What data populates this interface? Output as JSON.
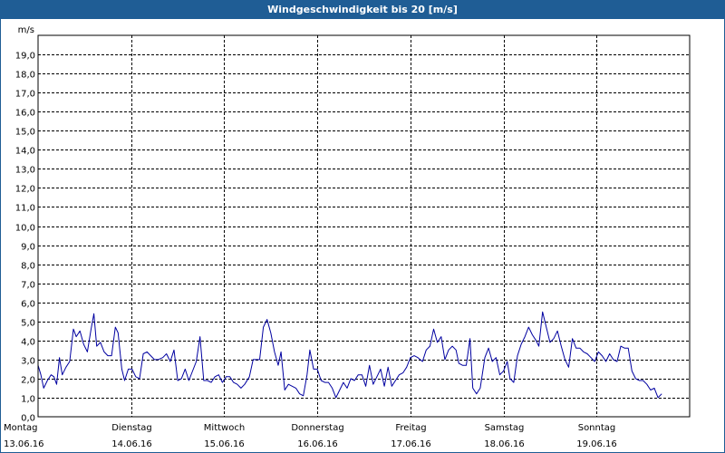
{
  "window": {
    "title": "Windgeschwindigkeit bis 20 [m/s]"
  },
  "colors": {
    "titlebar": "#1f5d95",
    "series": "#0000a0",
    "grid": "#000000"
  },
  "chart_data": {
    "type": "line",
    "title": "Windgeschwindigkeit bis 20 [m/s]",
    "ylabel": "m/s",
    "ylim": [
      0,
      20
    ],
    "y_ticks": [
      "0,0",
      "1,0",
      "2,0",
      "3,0",
      "4,0",
      "5,0",
      "6,0",
      "7,0",
      "8,0",
      "9,0",
      "10,0",
      "11,0",
      "12,0",
      "13,0",
      "14,0",
      "15,0",
      "16,0",
      "17,0",
      "18,0",
      "19,0"
    ],
    "x_unit": "days since 13.06.16 00:00",
    "xlim": [
      0,
      7
    ],
    "x_labels": [
      {
        "day": "Montag",
        "date": "13.06.16"
      },
      {
        "day": "Dienstag",
        "date": "14.06.16"
      },
      {
        "day": "Mittwoch",
        "date": "15.06.16"
      },
      {
        "day": "Donnerstag",
        "date": "16.06.16"
      },
      {
        "day": "Freitag",
        "date": "17.06.16"
      },
      {
        "day": "Samstag",
        "date": "18.06.16"
      },
      {
        "day": "Sonntag",
        "date": "19.06.16"
      }
    ],
    "grid": true,
    "series": [
      {
        "name": "",
        "color": "#0000a0",
        "points": [
          [
            0.0,
            2.7
          ],
          [
            0.03,
            2.2
          ],
          [
            0.06,
            1.5
          ],
          [
            0.1,
            1.9
          ],
          [
            0.14,
            2.2
          ],
          [
            0.17,
            2.1
          ],
          [
            0.2,
            1.7
          ],
          [
            0.23,
            3.1
          ],
          [
            0.26,
            2.2
          ],
          [
            0.3,
            2.6
          ],
          [
            0.34,
            2.9
          ],
          [
            0.38,
            4.6
          ],
          [
            0.41,
            4.2
          ],
          [
            0.45,
            4.5
          ],
          [
            0.49,
            3.8
          ],
          [
            0.53,
            3.4
          ],
          [
            0.57,
            4.6
          ],
          [
            0.6,
            5.4
          ],
          [
            0.63,
            3.7
          ],
          [
            0.67,
            3.9
          ],
          [
            0.71,
            3.4
          ],
          [
            0.75,
            3.2
          ],
          [
            0.79,
            3.2
          ],
          [
            0.83,
            4.7
          ],
          [
            0.86,
            4.4
          ],
          [
            0.9,
            2.5
          ],
          [
            0.93,
            1.9
          ],
          [
            0.97,
            2.5
          ],
          [
            1.01,
            2.5
          ],
          [
            1.05,
            2.1
          ],
          [
            1.09,
            2.0
          ],
          [
            1.13,
            3.3
          ],
          [
            1.17,
            3.4
          ],
          [
            1.21,
            3.2
          ],
          [
            1.25,
            3.0
          ],
          [
            1.29,
            3.0
          ],
          [
            1.34,
            3.1
          ],
          [
            1.38,
            3.3
          ],
          [
            1.42,
            2.9
          ],
          [
            1.46,
            3.5
          ],
          [
            1.5,
            1.9
          ],
          [
            1.54,
            2.0
          ],
          [
            1.58,
            2.5
          ],
          [
            1.62,
            1.9
          ],
          [
            1.66,
            2.4
          ],
          [
            1.7,
            2.9
          ],
          [
            1.74,
            4.2
          ],
          [
            1.78,
            1.9
          ],
          [
            1.82,
            1.9
          ],
          [
            1.86,
            1.8
          ],
          [
            1.9,
            2.1
          ],
          [
            1.94,
            2.2
          ],
          [
            1.98,
            1.8
          ],
          [
            2.02,
            2.1
          ],
          [
            2.06,
            2.1
          ],
          [
            2.1,
            1.8
          ],
          [
            2.14,
            1.7
          ],
          [
            2.18,
            1.5
          ],
          [
            2.22,
            1.7
          ],
          [
            2.27,
            2.1
          ],
          [
            2.31,
            3.0
          ],
          [
            2.35,
            3.0
          ],
          [
            2.38,
            3.0
          ],
          [
            2.42,
            4.7
          ],
          [
            2.46,
            5.1
          ],
          [
            2.5,
            4.4
          ],
          [
            2.54,
            3.4
          ],
          [
            2.58,
            2.7
          ],
          [
            2.61,
            3.4
          ],
          [
            2.65,
            1.4
          ],
          [
            2.69,
            1.7
          ],
          [
            2.73,
            1.6
          ],
          [
            2.77,
            1.5
          ],
          [
            2.81,
            1.2
          ],
          [
            2.85,
            1.1
          ],
          [
            2.89,
            2.2
          ],
          [
            2.92,
            3.5
          ],
          [
            2.96,
            2.5
          ],
          [
            3.0,
            2.5
          ],
          [
            3.04,
            1.9
          ],
          [
            3.08,
            1.8
          ],
          [
            3.12,
            1.8
          ],
          [
            3.16,
            1.5
          ],
          [
            3.2,
            1.0
          ],
          [
            3.24,
            1.4
          ],
          [
            3.28,
            1.8
          ],
          [
            3.32,
            1.5
          ],
          [
            3.36,
            2.0
          ],
          [
            3.4,
            1.9
          ],
          [
            3.44,
            2.2
          ],
          [
            3.48,
            2.2
          ],
          [
            3.52,
            1.6
          ],
          [
            3.56,
            2.7
          ],
          [
            3.6,
            1.7
          ],
          [
            3.64,
            2.1
          ],
          [
            3.68,
            2.5
          ],
          [
            3.72,
            1.6
          ],
          [
            3.76,
            2.6
          ],
          [
            3.8,
            1.6
          ],
          [
            3.84,
            1.9
          ],
          [
            3.88,
            2.2
          ],
          [
            3.92,
            2.3
          ],
          [
            3.96,
            2.6
          ],
          [
            4.0,
            3.1
          ],
          [
            4.04,
            3.2
          ],
          [
            4.08,
            3.1
          ],
          [
            4.13,
            2.9
          ],
          [
            4.17,
            3.5
          ],
          [
            4.21,
            3.7
          ],
          [
            4.25,
            4.6
          ],
          [
            4.29,
            3.9
          ],
          [
            4.33,
            4.2
          ],
          [
            4.37,
            3.0
          ],
          [
            4.41,
            3.5
          ],
          [
            4.45,
            3.7
          ],
          [
            4.49,
            3.5
          ],
          [
            4.52,
            2.8
          ],
          [
            4.56,
            2.7
          ],
          [
            4.6,
            2.7
          ],
          [
            4.64,
            4.1
          ],
          [
            4.67,
            1.5
          ],
          [
            4.71,
            1.2
          ],
          [
            4.75,
            1.5
          ],
          [
            4.8,
            3.1
          ],
          [
            4.84,
            3.6
          ],
          [
            4.88,
            2.9
          ],
          [
            4.92,
            3.1
          ],
          [
            4.96,
            2.2
          ],
          [
            5.0,
            2.4
          ],
          [
            5.04,
            2.9
          ],
          [
            5.07,
            2.0
          ],
          [
            5.11,
            1.8
          ],
          [
            5.15,
            3.2
          ],
          [
            5.19,
            3.8
          ],
          [
            5.23,
            4.2
          ],
          [
            5.27,
            4.7
          ],
          [
            5.31,
            4.3
          ],
          [
            5.35,
            4.0
          ],
          [
            5.38,
            3.7
          ],
          [
            5.42,
            5.5
          ],
          [
            5.46,
            4.7
          ],
          [
            5.5,
            3.9
          ],
          [
            5.54,
            4.1
          ],
          [
            5.58,
            4.5
          ],
          [
            5.62,
            3.7
          ],
          [
            5.66,
            3.0
          ],
          [
            5.7,
            2.6
          ],
          [
            5.74,
            4.1
          ],
          [
            5.78,
            3.6
          ],
          [
            5.82,
            3.6
          ],
          [
            5.86,
            3.4
          ],
          [
            5.9,
            3.3
          ],
          [
            5.94,
            3.1
          ],
          [
            5.98,
            2.9
          ],
          [
            6.02,
            3.4
          ],
          [
            6.06,
            3.2
          ],
          [
            6.1,
            2.9
          ],
          [
            6.14,
            3.3
          ],
          [
            6.18,
            3.0
          ],
          [
            6.22,
            2.9
          ],
          [
            6.26,
            3.7
          ],
          [
            6.3,
            3.6
          ],
          [
            6.34,
            3.6
          ],
          [
            6.38,
            2.4
          ],
          [
            6.42,
            2.0
          ],
          [
            6.46,
            1.9
          ],
          [
            6.5,
            1.9
          ],
          [
            6.54,
            1.7
          ],
          [
            6.58,
            1.4
          ],
          [
            6.62,
            1.5
          ],
          [
            6.66,
            1.0
          ],
          [
            6.7,
            1.2
          ]
        ]
      }
    ]
  }
}
